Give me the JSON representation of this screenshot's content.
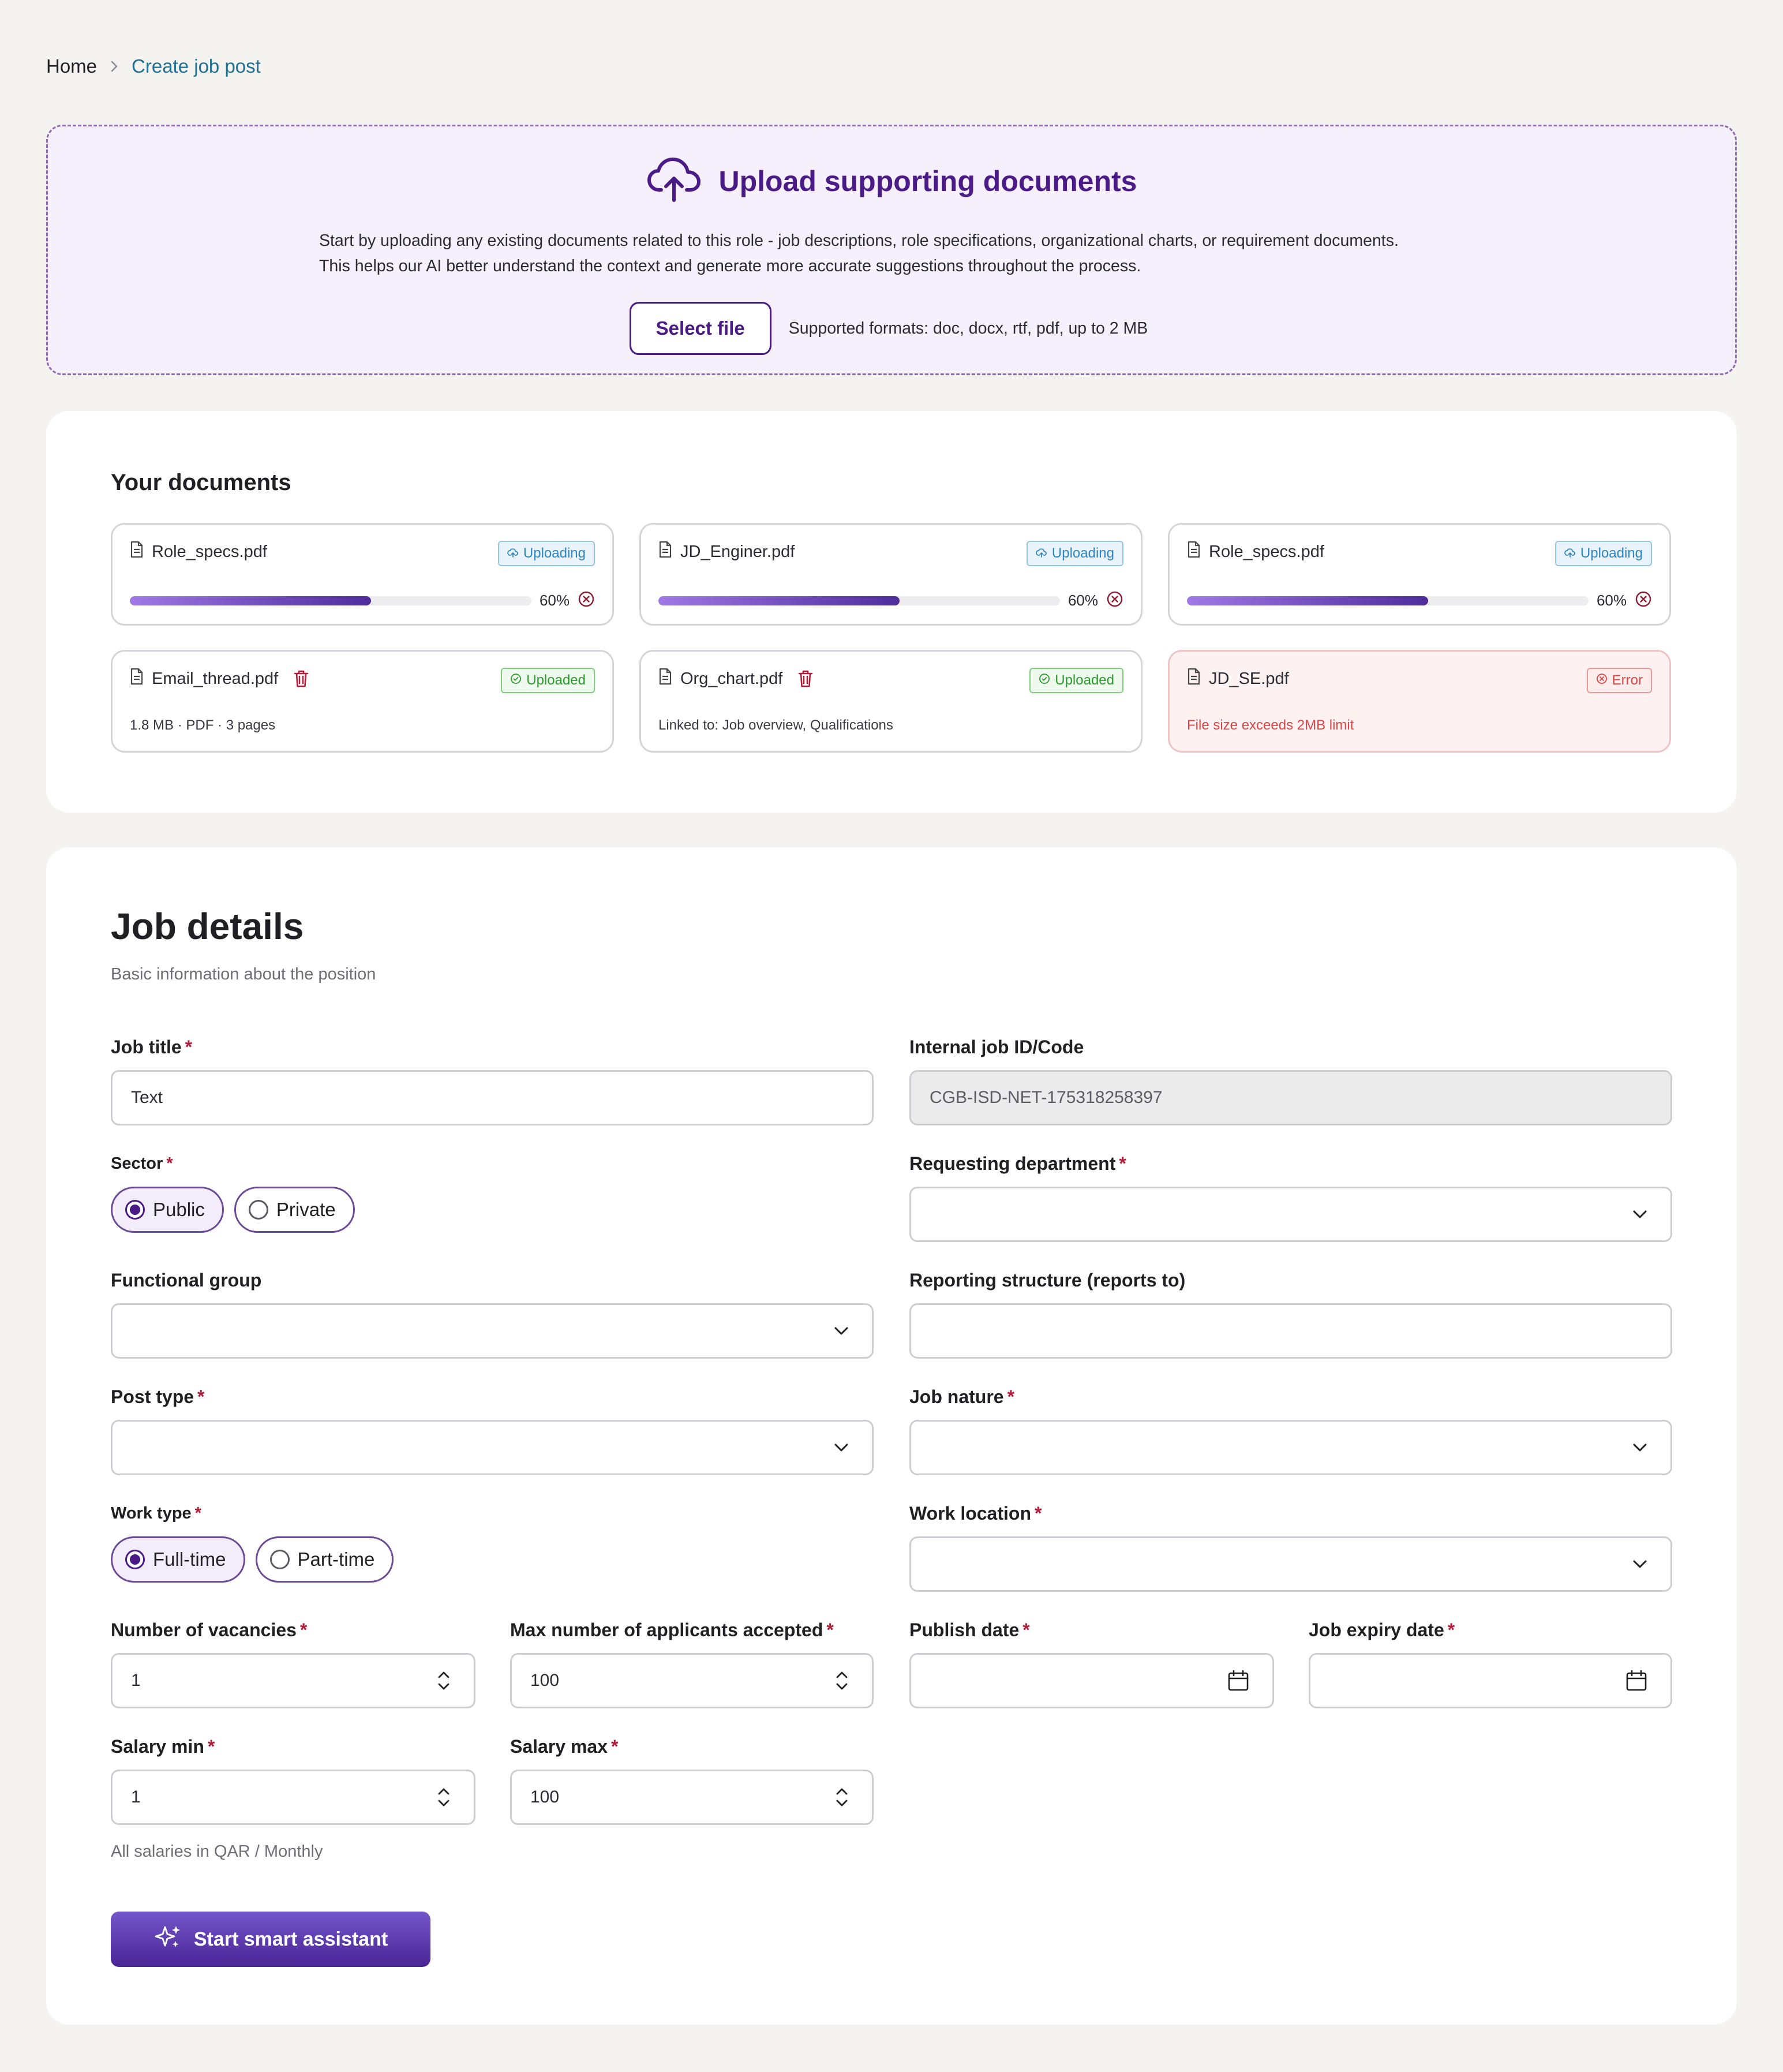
{
  "breadcrumb": {
    "home": "Home",
    "current": "Create job post"
  },
  "upload": {
    "title": "Upload supporting documents",
    "desc_line1": "Start by uploading any existing documents related to this role - job descriptions, role specifications, organizational charts, or requirement documents.",
    "desc_line2": "This helps our AI better understand the context and generate more accurate suggestions throughout the process.",
    "select_label": "Select file",
    "formats": "Supported formats: doc, docx, rtf, pdf, up to 2 MB",
    "icon": "cloud-upload-icon"
  },
  "documents": {
    "title": "Your documents",
    "items": [
      {
        "name": "Role_specs.pdf",
        "status": "Uploading",
        "progress_label": "60%",
        "progress": 0.6
      },
      {
        "name": "JD_Enginer.pdf",
        "status": "Uploading",
        "progress_label": "60%",
        "progress": 0.6
      },
      {
        "name": "Role_specs.pdf",
        "status": "Uploading",
        "progress_label": "60%",
        "progress": 0.6
      },
      {
        "name": "Email_thread.pdf",
        "status": "Uploaded",
        "meta": "1.8 MB · PDF · 3 pages"
      },
      {
        "name": "Org_chart.pdf",
        "status": "Uploaded",
        "meta": "Linked to: Job overview, Qualifications"
      },
      {
        "name": "JD_SE.pdf",
        "status": "Error",
        "meta": "File size exceeds 2MB limit"
      }
    ]
  },
  "job": {
    "title": "Job details",
    "subtitle": "Basic information about the position",
    "job_title": {
      "label": "Job title",
      "value": "Text"
    },
    "internal_id": {
      "label": "Internal job ID/Code",
      "value": "CGB-ISD-NET-175318258397"
    },
    "sector": {
      "label": "Sector",
      "options": [
        "Public",
        "Private"
      ],
      "selected": "Public"
    },
    "requesting_department": {
      "label": "Requesting department",
      "value": ""
    },
    "functional_group": {
      "label": "Functional group",
      "value": ""
    },
    "reporting_structure": {
      "label": "Reporting structure (reports to)",
      "value": ""
    },
    "post_type": {
      "label": "Post type",
      "value": ""
    },
    "job_nature": {
      "label": "Job nature",
      "value": ""
    },
    "work_type": {
      "label": "Work type",
      "options": [
        "Full-time",
        "Part-time"
      ],
      "selected": "Full-time"
    },
    "work_location": {
      "label": "Work location",
      "value": ""
    },
    "vacancies": {
      "label": "Number of vacancies",
      "value": "1"
    },
    "max_applicants": {
      "label": "Max number of applicants accepted",
      "value": "100"
    },
    "publish_date": {
      "label": "Publish date",
      "value": ""
    },
    "expiry_date": {
      "label": "Job expiry date",
      "value": ""
    },
    "salary_min": {
      "label": "Salary min",
      "value": "1"
    },
    "salary_max": {
      "label": "Salary max",
      "value": "100"
    },
    "salary_note": "All salaries in QAR / Monthly",
    "assist_label": "Start smart assistant",
    "required_marker": "*"
  },
  "colors": {
    "accent": "#4a1a86",
    "link": "#1f6f93",
    "error": "#d94747",
    "success": "#2d9a2f",
    "info": "#3186c2"
  }
}
